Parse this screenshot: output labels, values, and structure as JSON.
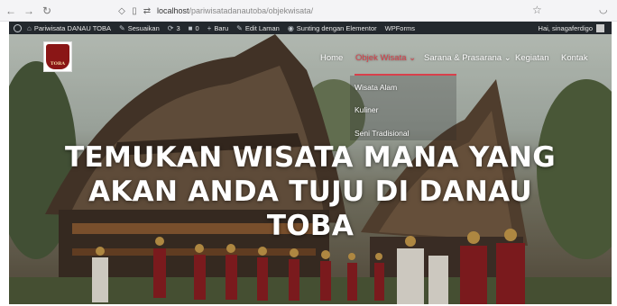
{
  "browser": {
    "back_icon": "←",
    "forward_icon": "→",
    "reload_icon": "↻",
    "url_host": "localhost",
    "url_path": "/pariwisatadanautoba/objekwisata/"
  },
  "admin_bar": {
    "site_name": "Pariwisata DANAU TOBA",
    "customize": "Sesuaikan",
    "updates_count": "3",
    "comments_count": "0",
    "new_label": "Baru",
    "edit_page": "Edit Laman",
    "elementor": "Sunting dengan Elementor",
    "wpforms": "WPForms",
    "greeting": "Hai, sinagaferdigo"
  },
  "site": {
    "logo_text": "TOBA",
    "nav": {
      "home": "Home",
      "objek_wisata": "Objek Wisata",
      "sarana": "Sarana & Prasarana",
      "kegiatan": "Kegiatan",
      "kontak": "Kontak"
    },
    "submenu": [
      "Wisata Alam",
      "Kuliner",
      "Seni Tradisional"
    ],
    "headline_lines": [
      "TEMUKAN WISATA MANA YANG",
      "AKAN ANDA TUJU DI DANAU",
      "TOBA"
    ]
  },
  "colors": {
    "accent": "#d8404b",
    "admin_bar": "#23282d"
  }
}
